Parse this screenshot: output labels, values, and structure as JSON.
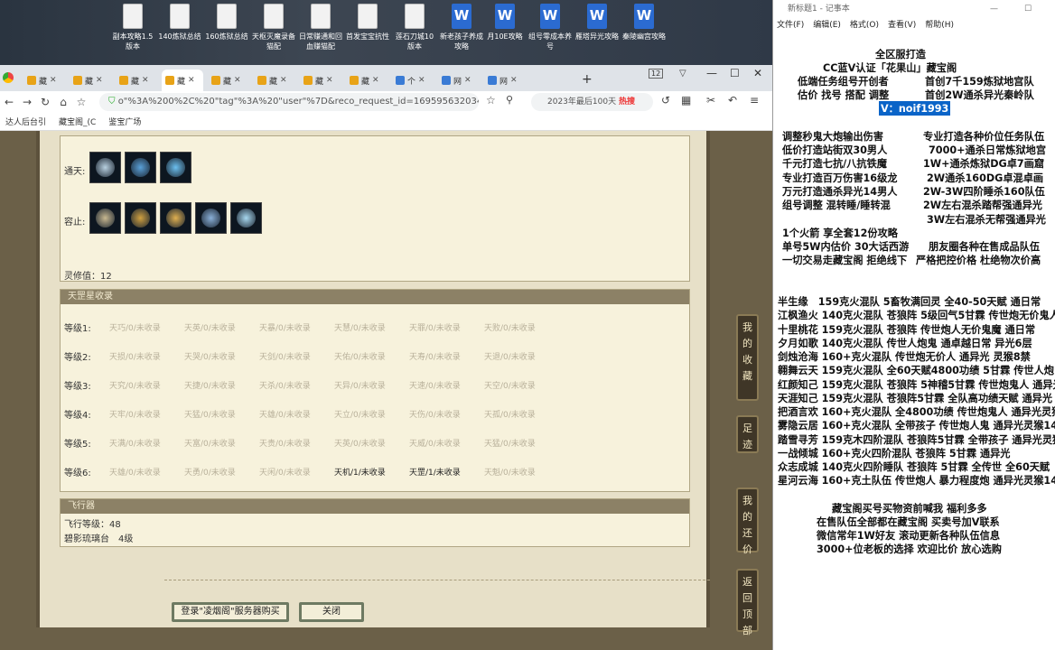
{
  "desktop": {
    "icons": [
      {
        "label": "副本攻略1.5版本",
        "type": "file"
      },
      {
        "label": "140炼狱总结",
        "type": "file"
      },
      {
        "label": "160炼狱总结",
        "type": "file"
      },
      {
        "label": "天枢灭魔录备猫配",
        "type": "file"
      },
      {
        "label": "日常赚通和回血赚猫配",
        "type": "file"
      },
      {
        "label": "首发宝宝抗性",
        "type": "file"
      },
      {
        "label": "莲石刀城10版本",
        "type": "file"
      },
      {
        "label": "新老孩子养成攻略",
        "type": "word"
      },
      {
        "label": "月10E攻略",
        "type": "word"
      },
      {
        "label": "组号零成本养号",
        "type": "word"
      },
      {
        "label": "雁塔异光攻略",
        "type": "word"
      },
      {
        "label": "秦陵幽宫攻略",
        "type": "word"
      }
    ]
  },
  "browser": {
    "tabs": [
      {
        "label": "藏"
      },
      {
        "label": "藏"
      },
      {
        "label": "藏"
      },
      {
        "label": "藏"
      },
      {
        "label": "藏"
      },
      {
        "label": "藏"
      },
      {
        "label": "藏"
      },
      {
        "label": "藏"
      },
      {
        "label": "个"
      },
      {
        "label": "网"
      },
      {
        "label": "网"
      }
    ],
    "tab_count": "12",
    "url": "o\"%3A%200%2C%20\"tag\"%3A%20\"user\"%7D&reco_request_id=1695956320344p2IOD",
    "search_text": "2023年最后100天",
    "search_badge": "热搜",
    "bookmarks": [
      "达人后台引",
      "藏宝阁_(C",
      "鉴宝广场"
    ]
  },
  "game": {
    "top_rows": [
      {
        "label": "通天:",
        "items": [
          "#b8d0e0",
          "#5aa0d8",
          "#6cc0f0"
        ]
      },
      {
        "label": "容止:",
        "items": [
          "#c8b890",
          "#d0a040",
          "#e0b050",
          "#8ab0d8",
          "#a8d8f0"
        ]
      }
    ],
    "lingxiu": "灵修值：12",
    "tianting_title": "天罡星收录",
    "levels": [
      {
        "label": "等级1:",
        "cells": [
          {
            "t": "天巧/0/未收录",
            "on": false
          },
          {
            "t": "天英/0/未收录",
            "on": false
          },
          {
            "t": "天暴/0/未收录",
            "on": false
          },
          {
            "t": "天慧/0/未收录",
            "on": false
          },
          {
            "t": "天罪/0/未收录",
            "on": false
          },
          {
            "t": "天败/0/未收录",
            "on": false
          }
        ]
      },
      {
        "label": "等级2:",
        "cells": [
          {
            "t": "天损/0/未收录",
            "on": false
          },
          {
            "t": "天哭/0/未收录",
            "on": false
          },
          {
            "t": "天剑/0/未收录",
            "on": false
          },
          {
            "t": "天佑/0/未收录",
            "on": false
          },
          {
            "t": "天寿/0/未收录",
            "on": false
          },
          {
            "t": "天退/0/未收录",
            "on": false
          }
        ]
      },
      {
        "label": "等级3:",
        "cells": [
          {
            "t": "天究/0/未收录",
            "on": false
          },
          {
            "t": "天捷/0/未收录",
            "on": false
          },
          {
            "t": "天杀/0/未收录",
            "on": false
          },
          {
            "t": "天异/0/未收录",
            "on": false
          },
          {
            "t": "天速/0/未收录",
            "on": false
          },
          {
            "t": "天空/0/未收录",
            "on": false
          }
        ]
      },
      {
        "label": "等级4:",
        "cells": [
          {
            "t": "天牢/0/未收录",
            "on": false
          },
          {
            "t": "天猛/0/未收录",
            "on": false
          },
          {
            "t": "天雄/0/未收录",
            "on": false
          },
          {
            "t": "天立/0/未收录",
            "on": false
          },
          {
            "t": "天伤/0/未收录",
            "on": false
          },
          {
            "t": "天孤/0/未收录",
            "on": false
          }
        ]
      },
      {
        "label": "等级5:",
        "cells": [
          {
            "t": "天满/0/未收录",
            "on": false
          },
          {
            "t": "天富/0/未收录",
            "on": false
          },
          {
            "t": "天贵/0/未收录",
            "on": false
          },
          {
            "t": "天英/0/未收录",
            "on": false
          },
          {
            "t": "天威/0/未收录",
            "on": false
          },
          {
            "t": "天猛/0/未收录",
            "on": false
          }
        ]
      },
      {
        "label": "等级6:",
        "cells": [
          {
            "t": "天雄/0/未收录",
            "on": false
          },
          {
            "t": "天勇/0/未收录",
            "on": false
          },
          {
            "t": "天闲/0/未收录",
            "on": false
          },
          {
            "t": "天机/1/未收录",
            "on": true
          },
          {
            "t": "天罡/1/未收录",
            "on": true
          },
          {
            "t": "天魁/0/未收录",
            "on": false
          }
        ]
      }
    ],
    "flyer_title": "飞行器",
    "flyer_level": "飞行等级：48",
    "flyer_item": "碧影琉璃台　4级",
    "btn_buy": "登录\"凌烟阁\"服务器购买",
    "btn_close": "关闭",
    "side_buttons": [
      "我的收藏",
      "足迹",
      "我的还价",
      "返回顶部"
    ]
  },
  "notepad": {
    "title": "新标题1 - 记事本",
    "menu": [
      "文件(F)",
      "编辑(E)",
      "格式(O)",
      "查看(V)",
      "帮助(H)"
    ],
    "lines": [
      "全区服打造",
      "CC蓝V认证「花果山」藏宝阁",
      "低端任务组号开创者",
      "首创7千159炼狱地宫队",
      "估价 找号 搭配 调整",
      "首创2W通杀异光秦岭队",
      "V：noif1993",
      "调整秒鬼大炮输出伤害",
      "专业打造各种价位任务队伍",
      "低价打造站街双30男人",
      "7000+通杀日常炼狱地宫",
      "千元打造七抗/八抗铁魔",
      "1W+通杀炼狱DG卓7画窟",
      "专业打造百万伤害16级龙",
      "2W通杀160DG卓混卓画",
      "万元打造通杀异光14男人",
      "2W-3W四阶睡杀160队伍",
      "组号调整 混转睡/睡转混",
      "2W左右混杀踏帮强通异光",
      "3W左右混杀无帮强通异光",
      "1个火箭 享全套12份攻略",
      "单号5W内估价 30大话西游",
      "朋友圈各种在售成品队伍",
      "一切交易走藏宝阁 拒绝线下",
      "严格把控价格 杜绝物次价高",
      "半生缘　159克火混队 5畜牧满回灵 全40-50天赋 通日常",
      "江枫渔火 140克火混队 苍狼阵 5级回气5甘霖 传世炮无价鬼人",
      "十里桃花 159克火混队 苍狼阵 传世炮人无价鬼魔 通日常",
      "夕月如歌 140克火混队 传世人炮鬼 通卓越日常 异光6层",
      "剑烛沧海 160+克火混队 传世炮无价人 通异光 灵猴8禁",
      "翱舞云天 159克火混队 全60天赋4800功绩 5甘霖 传世人炮",
      "红颜知己 159克火混队 苍狼阵 5神稽5甘霖 传世炮鬼人 通异光",
      "天涯知己 159克火混队 苍狼阵5甘霖 全队高功绩天赋 通异光",
      "把酒言欢 160+克火混队 全4800功绩 传世炮鬼人 通异光灵猴",
      "雾隐云居 160+克火混队 全带孩子 传世炮人鬼 通异光灵猴14",
      "踏雪寻芳 159克木四阶混队 苍狼阵5甘霖 全带孩子 通异光灵猴",
      "一战倾城 160+克火四阶混队 苍狼阵 5甘霖 通异光",
      "众志成城 140克火四阶睡队 苍狼阵 5甘霖 全传世 全60天赋",
      "星河云海 160+克土队伍 传世炮人 暴力程度炮 通异光灵猴14",
      "藏宝阁买号买物资前喊我 福利多多",
      "在售队伍全部都在藏宝阁 买卖号加V联系",
      "微信常年1W好友 滚动更新各种队伍信息",
      "3000+位老板的选择 欢迎比价 放心选购"
    ]
  }
}
